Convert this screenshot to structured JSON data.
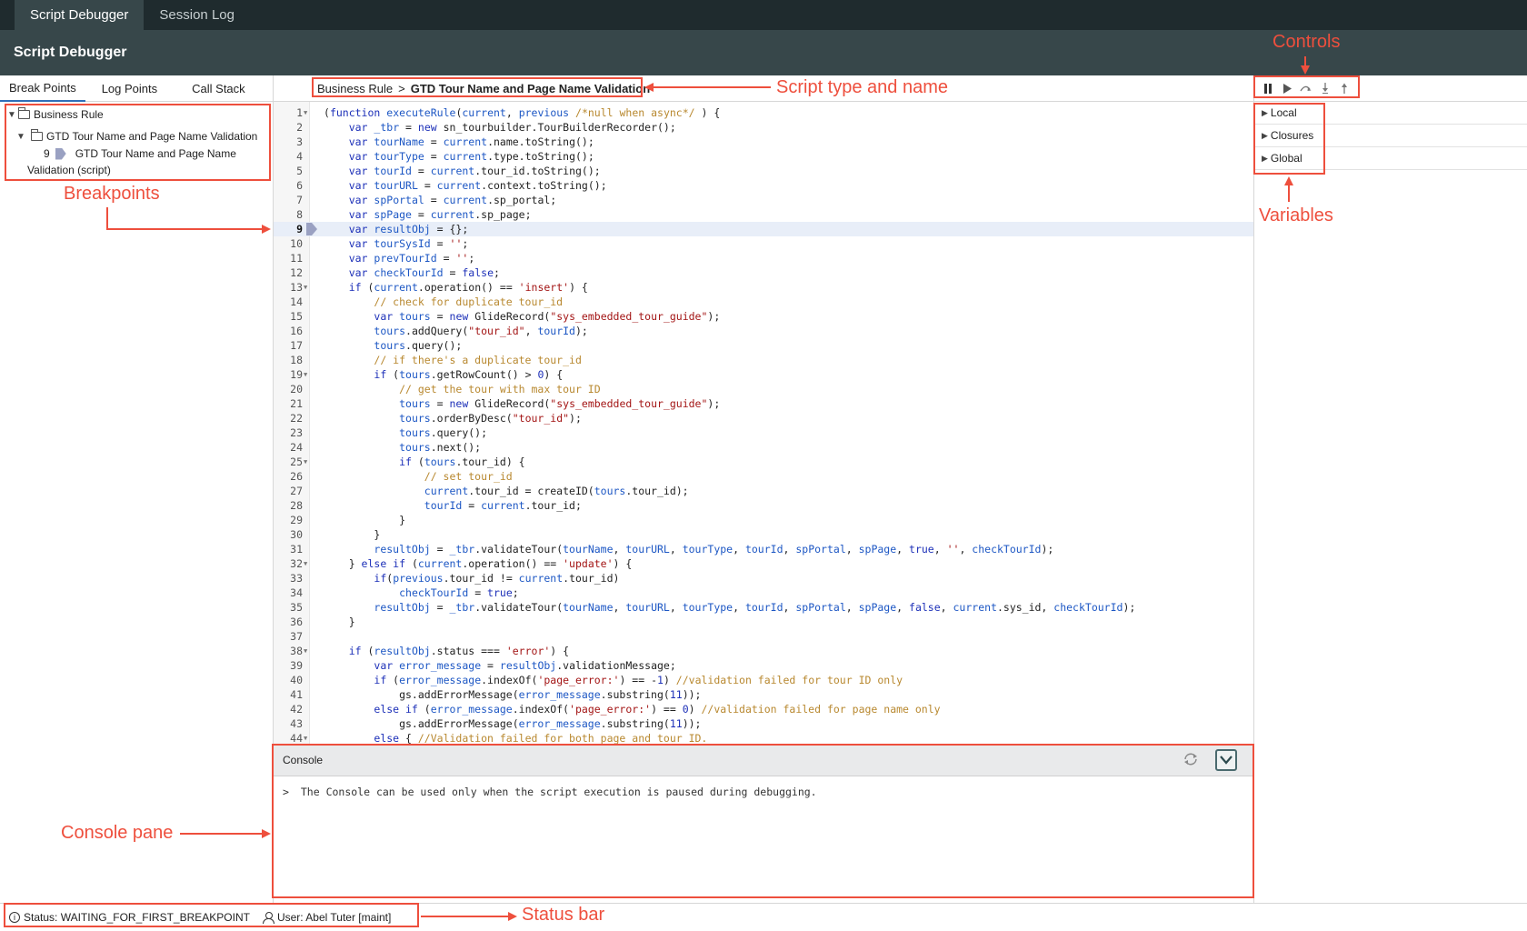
{
  "topbar": {
    "tabs": [
      {
        "label": "Script Debugger"
      },
      {
        "label": "Session Log"
      }
    ]
  },
  "header": {
    "title": "Script Debugger"
  },
  "left_panel": {
    "tabs": [
      {
        "label": "Break Points"
      },
      {
        "label": "Log Points"
      },
      {
        "label": "Call Stack"
      }
    ],
    "tree": {
      "root": "Business Rule",
      "child": "GTD Tour Name and Page Name Validation",
      "breakpoint_line": "9",
      "breakpoint_label_1": "GTD Tour Name and Page Name",
      "breakpoint_label_2": "Validation (script)"
    }
  },
  "breadcrumb": {
    "type": "Business Rule",
    "separator": ">",
    "name": "GTD Tour Name and Page Name Validation"
  },
  "variables": {
    "sections": [
      {
        "label": "Local"
      },
      {
        "label": "Closures"
      },
      {
        "label": "Global"
      }
    ]
  },
  "console": {
    "title": "Console",
    "message": "The Console can be used only when the script execution is paused during debugging."
  },
  "status": {
    "status_text": "Status: WAITING_FOR_FIRST_BREAKPOINT",
    "user_text": "User: Abel Tuter [maint]"
  },
  "annotations": {
    "controls": "Controls",
    "script_type": "Script type and name",
    "breakpoints": "Breakpoints",
    "variables": "Variables",
    "console_pane": "Console pane",
    "status_bar": "Status bar"
  },
  "code_lines": [
    {
      "n": "1",
      "fold": true,
      "html": "(<span class=\"k\">function</span> <span class=\"v\">executeRule</span>(<span class=\"v\">current</span>, <span class=\"v\">previous</span> <span class=\"c\">/*null when async*/</span> ) {"
    },
    {
      "n": "2",
      "html": "    <span class=\"k\">var</span> <span class=\"v\">_tbr</span> = <span class=\"k\">new</span> sn_tourbuilder.TourBuilderRecorder();"
    },
    {
      "n": "3",
      "html": "    <span class=\"k\">var</span> <span class=\"v\">tourName</span> = <span class=\"v\">current</span>.name.toString();"
    },
    {
      "n": "4",
      "html": "    <span class=\"k\">var</span> <span class=\"v\">tourType</span> = <span class=\"v\">current</span>.type.toString();"
    },
    {
      "n": "5",
      "html": "    <span class=\"k\">var</span> <span class=\"v\">tourId</span> = <span class=\"v\">current</span>.tour_id.toString();"
    },
    {
      "n": "6",
      "html": "    <span class=\"k\">var</span> <span class=\"v\">tourURL</span> = <span class=\"v\">current</span>.context.toString();"
    },
    {
      "n": "7",
      "html": "    <span class=\"k\">var</span> <span class=\"v\">spPortal</span> = <span class=\"v\">current</span>.sp_portal;"
    },
    {
      "n": "8",
      "html": "    <span class=\"k\">var</span> <span class=\"v\">spPage</span> = <span class=\"v\">current</span>.sp_page;"
    },
    {
      "n": "9",
      "current": true,
      "html": "    <span class=\"k\">var</span> <span class=\"v\">resultObj</span> = {};"
    },
    {
      "n": "10",
      "html": "    <span class=\"k\">var</span> <span class=\"v\">tourSysId</span> = <span class=\"s\">''</span>;"
    },
    {
      "n": "11",
      "html": "    <span class=\"k\">var</span> <span class=\"v\">prevTourId</span> = <span class=\"s\">''</span>;"
    },
    {
      "n": "12",
      "html": "    <span class=\"k\">var</span> <span class=\"v\">checkTourId</span> = <span class=\"k\">false</span>;"
    },
    {
      "n": "13",
      "fold": true,
      "html": "    <span class=\"k\">if</span> (<span class=\"v\">current</span>.operation() == <span class=\"s\">'insert'</span>) {"
    },
    {
      "n": "14",
      "html": "        <span class=\"c\">// check for duplicate tour_id</span>"
    },
    {
      "n": "15",
      "html": "        <span class=\"k\">var</span> <span class=\"v\">tours</span> = <span class=\"k\">new</span> GlideRecord(<span class=\"s\">\"sys_embedded_tour_guide\"</span>);"
    },
    {
      "n": "16",
      "html": "        <span class=\"v\">tours</span>.addQuery(<span class=\"s\">\"tour_id\"</span>, <span class=\"v\">tourId</span>);"
    },
    {
      "n": "17",
      "html": "        <span class=\"v\">tours</span>.query();"
    },
    {
      "n": "18",
      "html": "        <span class=\"c\">// if there's a duplicate tour_id</span>"
    },
    {
      "n": "19",
      "fold": true,
      "html": "        <span class=\"k\">if</span> (<span class=\"v\">tours</span>.getRowCount() &gt; <span class=\"n\">0</span>) {"
    },
    {
      "n": "20",
      "html": "            <span class=\"c\">// get the tour with max tour ID</span>"
    },
    {
      "n": "21",
      "html": "            <span class=\"v\">tours</span> = <span class=\"k\">new</span> GlideRecord(<span class=\"s\">\"sys_embedded_tour_guide\"</span>);"
    },
    {
      "n": "22",
      "html": "            <span class=\"v\">tours</span>.orderByDesc(<span class=\"s\">\"tour_id\"</span>);"
    },
    {
      "n": "23",
      "html": "            <span class=\"v\">tours</span>.query();"
    },
    {
      "n": "24",
      "html": "            <span class=\"v\">tours</span>.next();"
    },
    {
      "n": "25",
      "fold": true,
      "html": "            <span class=\"k\">if</span> (<span class=\"v\">tours</span>.tour_id) {"
    },
    {
      "n": "26",
      "html": "                <span class=\"c\">// set tour_id</span>"
    },
    {
      "n": "27",
      "html": "                <span class=\"v\">current</span>.tour_id = createID(<span class=\"v\">tours</span>.tour_id);"
    },
    {
      "n": "28",
      "html": "                <span class=\"v\">tourId</span> = <span class=\"v\">current</span>.tour_id;"
    },
    {
      "n": "29",
      "html": "            }"
    },
    {
      "n": "30",
      "html": "        }"
    },
    {
      "n": "31",
      "html": "        <span class=\"v\">resultObj</span> = <span class=\"v\">_tbr</span>.validateTour(<span class=\"v\">tourName</span>, <span class=\"v\">tourURL</span>, <span class=\"v\">tourType</span>, <span class=\"v\">tourId</span>, <span class=\"v\">spPortal</span>, <span class=\"v\">spPage</span>, <span class=\"k\">true</span>, <span class=\"s\">''</span>, <span class=\"v\">checkTourId</span>);"
    },
    {
      "n": "32",
      "fold": true,
      "html": "    } <span class=\"k\">else if</span> (<span class=\"v\">current</span>.operation() == <span class=\"s\">'update'</span>) {"
    },
    {
      "n": "33",
      "html": "        <span class=\"k\">if</span>(<span class=\"v\">previous</span>.tour_id != <span class=\"v\">current</span>.tour_id)"
    },
    {
      "n": "34",
      "html": "            <span class=\"v\">checkTourId</span> = <span class=\"k\">true</span>;"
    },
    {
      "n": "35",
      "html": "        <span class=\"v\">resultObj</span> = <span class=\"v\">_tbr</span>.validateTour(<span class=\"v\">tourName</span>, <span class=\"v\">tourURL</span>, <span class=\"v\">tourType</span>, <span class=\"v\">tourId</span>, <span class=\"v\">spPortal</span>, <span class=\"v\">spPage</span>, <span class=\"k\">false</span>, <span class=\"v\">current</span>.sys_id, <span class=\"v\">checkTourId</span>);"
    },
    {
      "n": "36",
      "html": "    }"
    },
    {
      "n": "37",
      "html": ""
    },
    {
      "n": "38",
      "fold": true,
      "html": "    <span class=\"k\">if</span> (<span class=\"v\">resultObj</span>.status === <span class=\"s\">'error'</span>) {"
    },
    {
      "n": "39",
      "html": "        <span class=\"k\">var</span> <span class=\"v\">error_message</span> = <span class=\"v\">resultObj</span>.validationMessage;"
    },
    {
      "n": "40",
      "html": "        <span class=\"k\">if</span> (<span class=\"v\">error_message</span>.indexOf(<span class=\"s\">'page_error:'</span>) == -<span class=\"n\">1</span>) <span class=\"c\">//validation failed for tour ID only</span>"
    },
    {
      "n": "41",
      "html": "            gs.addErrorMessage(<span class=\"v\">error_message</span>.substring(<span class=\"n\">11</span>));"
    },
    {
      "n": "42",
      "html": "        <span class=\"k\">else if</span> (<span class=\"v\">error_message</span>.indexOf(<span class=\"s\">'page_error:'</span>) == <span class=\"n\">0</span>) <span class=\"c\">//validation failed for page name only</span>"
    },
    {
      "n": "43",
      "html": "            gs.addErrorMessage(<span class=\"v\">error_message</span>.substring(<span class=\"n\">11</span>));"
    },
    {
      "n": "44",
      "fold": true,
      "html": "        <span class=\"k\">else</span> { <span class=\"c\">//Validation failed for both page and tour ID.</span>"
    }
  ]
}
